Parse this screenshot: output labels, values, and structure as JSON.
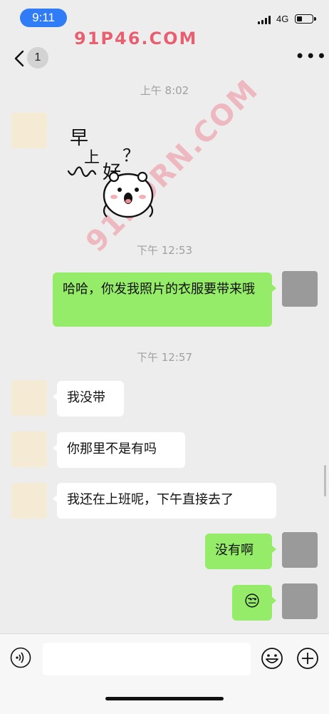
{
  "status": {
    "time": "9:11",
    "network": "4G"
  },
  "header": {
    "unread_count": "1"
  },
  "watermarks": [
    "91P46.COM",
    "91PORN.COM"
  ],
  "messages": [
    {
      "timestamp": "上午 8:02"
    },
    {
      "sticker_text": [
        "早",
        "上",
        "好",
        "？"
      ]
    },
    {
      "timestamp": "下午 12:53"
    },
    {
      "side": "right",
      "text": "哈哈，你发我照片的衣服要带来哦"
    },
    {
      "timestamp": "下午 12:57"
    },
    {
      "side": "left",
      "text": "我没带"
    },
    {
      "side": "left",
      "text": "你那里不是有吗"
    },
    {
      "side": "left",
      "text": "我还在上班呢，下午直接去了"
    },
    {
      "side": "right",
      "text": "没有啊"
    },
    {
      "side": "right",
      "emoji": "😒"
    }
  ],
  "colors": {
    "sent_bubble": "#95ec69",
    "received_bubble": "#ffffff",
    "background": "#ededed",
    "time_pill": "#2f7cf6"
  },
  "icons": [
    "back-arrow-icon",
    "more-icon",
    "voice-icon",
    "emoji-icon",
    "plus-icon"
  ]
}
